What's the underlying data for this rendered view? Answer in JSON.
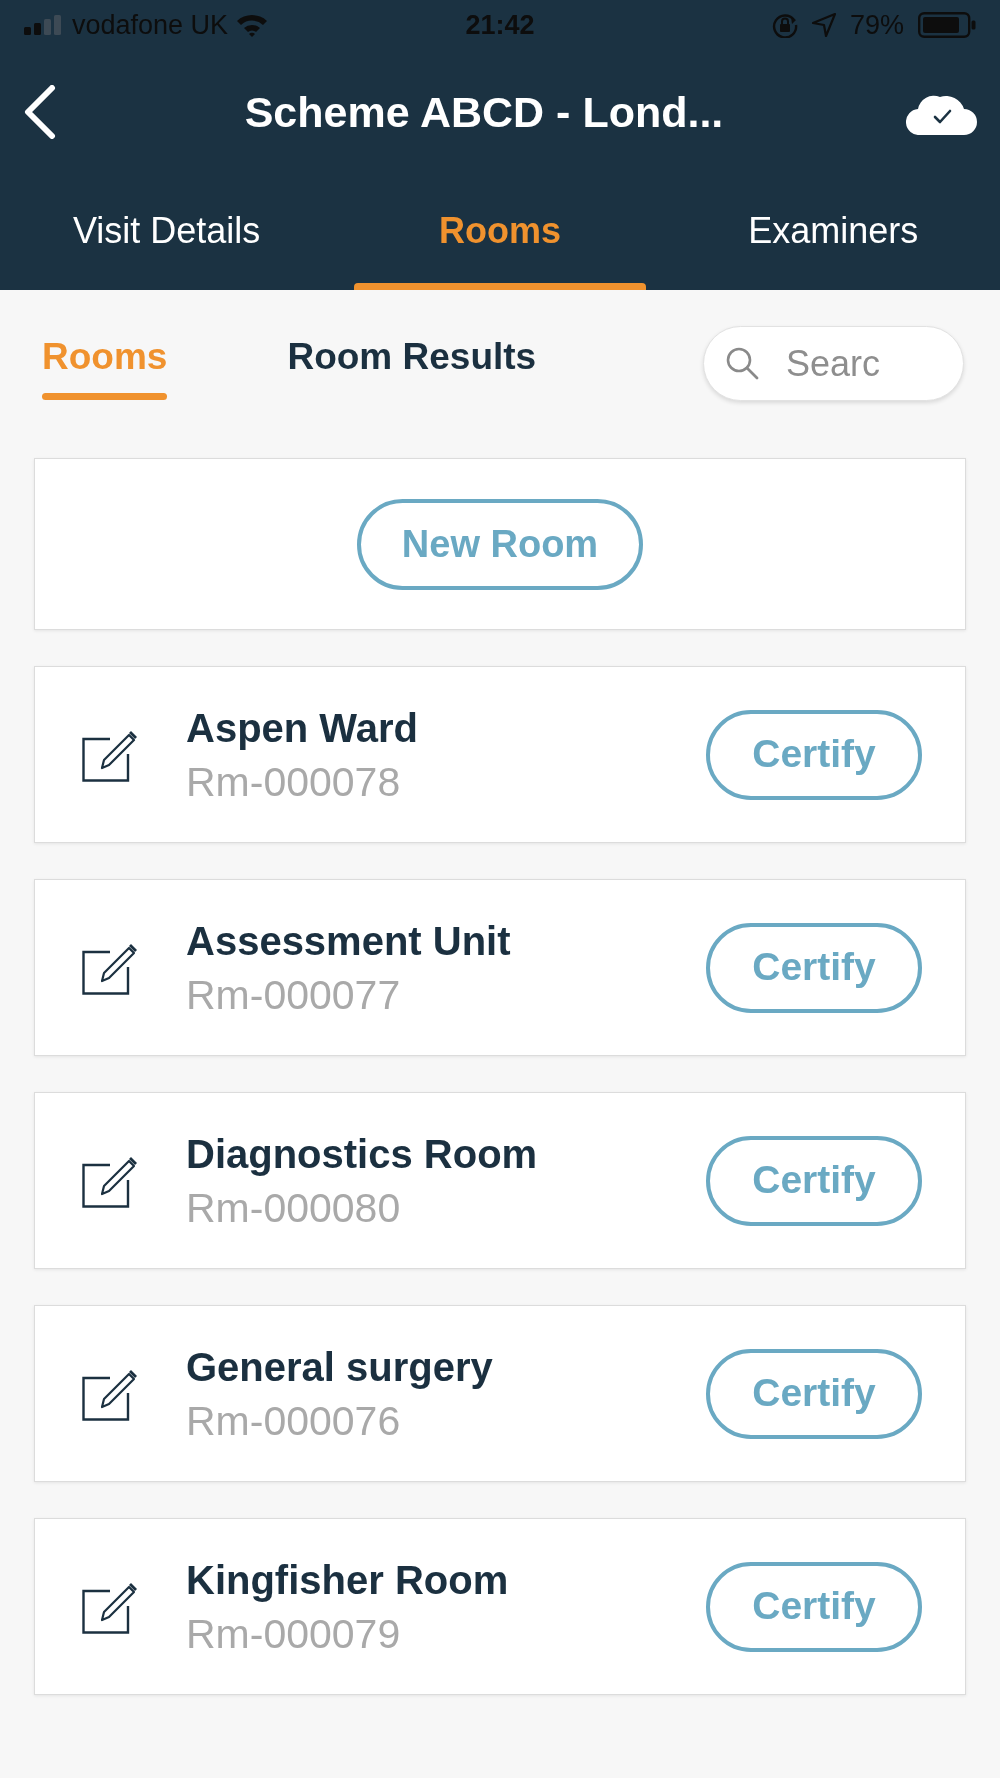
{
  "status_bar": {
    "carrier": "vodafone UK",
    "time": "21:42",
    "battery": "79%"
  },
  "header": {
    "title": "Scheme ABCD - Lond..."
  },
  "tabs": [
    {
      "label": "Visit Details",
      "selected": false
    },
    {
      "label": "Rooms",
      "selected": true
    },
    {
      "label": "Examiners",
      "selected": false
    }
  ],
  "sub_tabs": [
    {
      "label": "Rooms",
      "selected": true
    },
    {
      "label": "Room Results",
      "selected": false
    }
  ],
  "search": {
    "placeholder": "Searc"
  },
  "new_room_button": "New Room",
  "rooms": [
    {
      "name": "Aspen Ward",
      "id": "Rm-000078",
      "action": "Certify"
    },
    {
      "name": "Assessment Unit",
      "id": "Rm-000077",
      "action": "Certify"
    },
    {
      "name": "Diagnostics Room",
      "id": "Rm-000080",
      "action": "Certify"
    },
    {
      "name": "General surgery",
      "id": "Rm-000076",
      "action": "Certify"
    },
    {
      "name": "Kingfisher Room",
      "id": "Rm-000079",
      "action": "Certify"
    }
  ]
}
